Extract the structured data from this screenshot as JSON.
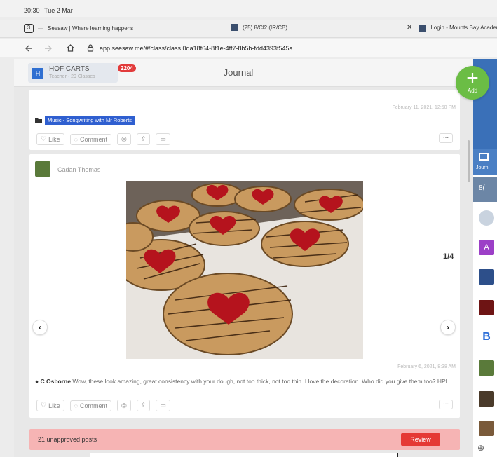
{
  "status_bar": {
    "time": "20:30",
    "date": "Tue 2 Mar"
  },
  "tabs": [
    {
      "label": "Seesaw | Where learning happens",
      "active": true
    },
    {
      "label": "(25) 8/Cl2 (IR/CB)",
      "active": false
    },
    {
      "label": "Login - Mounts Bay Academ",
      "active": false
    }
  ],
  "tab_count": "3",
  "close_glyph": "✕",
  "address_bar": {
    "url": "app.seesaw.me/#/class/class.0da18f64-8f1e-4ff7-8b5b-fdd4393f545a"
  },
  "class_header": {
    "avatar_letter": "H",
    "class_name": "HOF CARTS",
    "class_sub": "Teacher · 29 Classes",
    "notification_count": "2204"
  },
  "page_title": "Journal",
  "add_button": {
    "label": "Add"
  },
  "post_top": {
    "date": "February 11, 2021, 12:50 PM",
    "folder_tag": "Music - Songwriting with Mr Roberts",
    "actions": {
      "like": "Like",
      "comment": "Comment"
    },
    "more": "..."
  },
  "post_main": {
    "author": "Cadan Thomas",
    "photo_counter": "1/4",
    "date": "February 6, 2021, 8:38 AM",
    "comment": {
      "author": "C Osborne",
      "text": "Wow, these look amazing, great consistency with your dough, not too thick, not too thin. I love the decoration. Who did you give them too? HPL"
    },
    "actions": {
      "like": "Like",
      "comment": "Comment"
    },
    "more": "..."
  },
  "unapproved_bar": {
    "text": "21 unapproved posts",
    "button": "Review"
  },
  "right_panel": {
    "tab_label": "Journ",
    "class_code": "8(",
    "avatar_letter_a": "A",
    "avatar_letter_b": "B",
    "add_label": "⊕"
  },
  "colors": {
    "accent_green": "#6bbd45",
    "badge_red": "#e23b3b",
    "review_red": "#e53935",
    "seesaw_blue": "#3a70b8"
  }
}
